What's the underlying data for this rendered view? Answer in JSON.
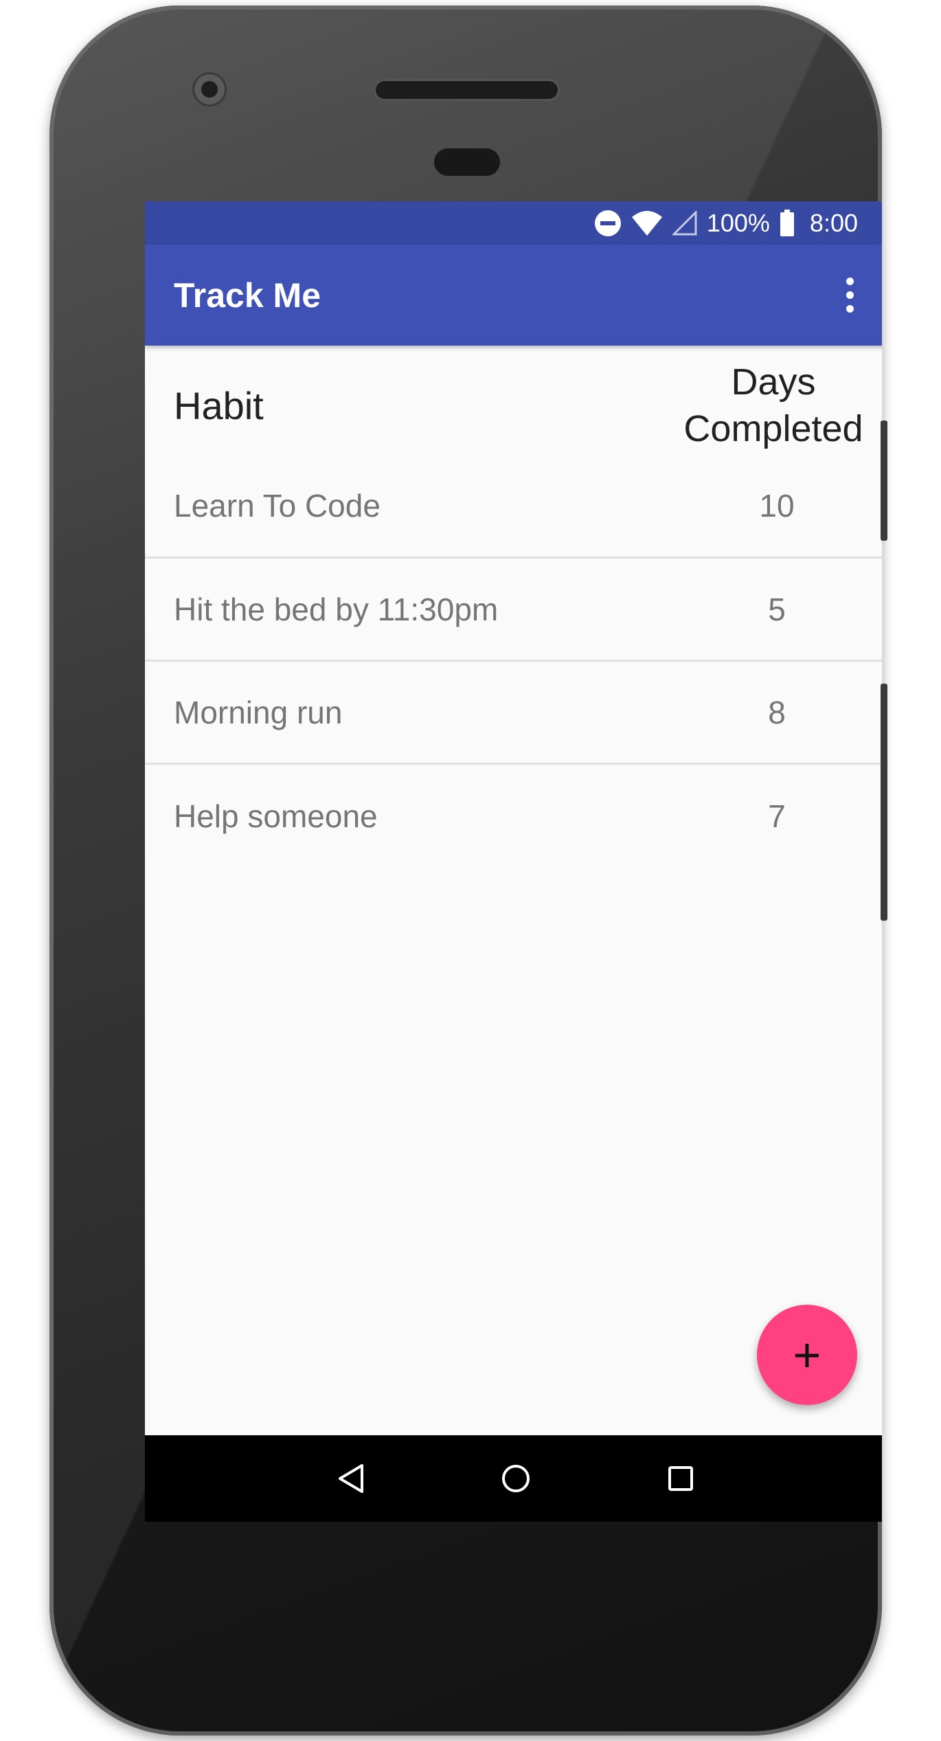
{
  "status_bar": {
    "battery_text": "100%",
    "time": "8:00",
    "icons": [
      "do-not-disturb-icon",
      "wifi-icon",
      "cell-signal-icon",
      "battery-icon"
    ]
  },
  "app_bar": {
    "title": "Track Me",
    "menu_icon": "overflow-menu-icon"
  },
  "table": {
    "header_habit": "Habit",
    "header_days_line1": "Days",
    "header_days_line2": "Completed",
    "rows": [
      {
        "habit": "Learn To Code",
        "days": "10"
      },
      {
        "habit": "Hit the bed by 11:30pm",
        "days": "5"
      },
      {
        "habit": "Morning run",
        "days": "8"
      },
      {
        "habit": "Help someone",
        "days": "7"
      }
    ]
  },
  "fab": {
    "label": "+",
    "icon": "add-icon"
  },
  "nav_bar": {
    "icons": [
      "back-icon",
      "home-icon",
      "recents-icon"
    ]
  },
  "colors": {
    "primary": "#3f51b5",
    "primary_dark": "#3849a4",
    "accent": "#ff4081",
    "background": "#fafafa"
  }
}
